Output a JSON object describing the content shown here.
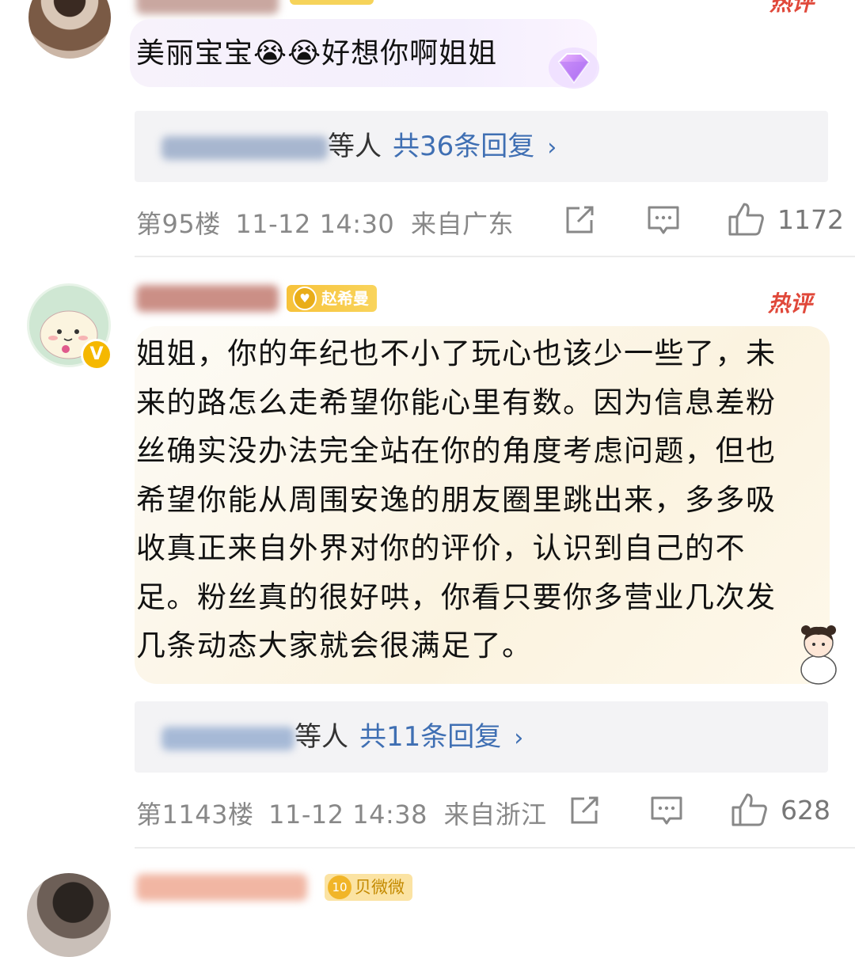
{
  "comment1": {
    "username": "欣欣_Betty",
    "hot_label": "热评",
    "text": "美丽宝宝😭😭好想你啊姐姐",
    "replies": {
      "who_suffix": "等人",
      "count_label": "共36条回复",
      "chevron": "›"
    },
    "meta": {
      "floor": "第95楼",
      "time": "11-12 14:30",
      "location": "来自广东"
    },
    "likes": "1172"
  },
  "comment2": {
    "badge_label": "赵希曼",
    "hot_label": "热评",
    "verified_mark": "V",
    "text": "姐姐，你的年纪也不小了玩心也该少一些了，未来的路怎么走希望你能心里有数。因为信息差粉丝确实没办法完全站在你的角度考虑问题，但也希望你能从周围安逸的朋友圈里跳出来，多多吸收真正来自外界对你的评价，认识到自己的不足。粉丝真的很好哄，你看只要你多营业几次发几条动态大家就会很满足了。",
    "replies": {
      "who_suffix": "等人",
      "count_label": "共11条回复",
      "chevron": "›"
    },
    "meta": {
      "floor": "第1143楼",
      "time": "11-12 14:38",
      "location": "来自浙江"
    },
    "likes": "628"
  },
  "comment3": {
    "badge_level": "10",
    "badge_label": "贝微微"
  },
  "icons": {
    "share": "share-icon",
    "comment": "comment-icon",
    "like": "thumbs-up-icon"
  }
}
